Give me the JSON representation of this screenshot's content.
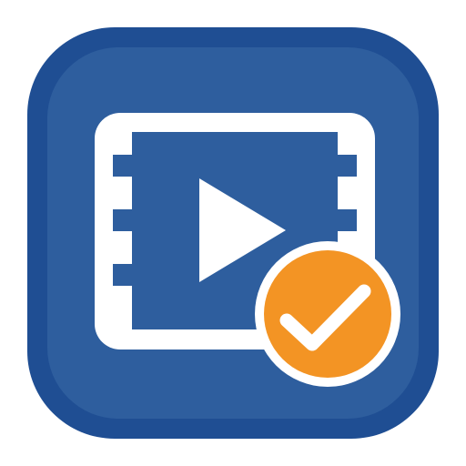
{
  "app_icon": {
    "name": "video-verified-app-icon",
    "icon_names": [
      "film-strip-icon",
      "play-icon",
      "checkmark-badge-icon"
    ],
    "colors": {
      "tile_outer": "#1f4e93",
      "tile_inner": "#2e5e9e",
      "film_frame": "#ffffff",
      "film_screen": "#2e5e9e",
      "play_triangle": "#ffffff",
      "badge_fill": "#f39424",
      "badge_ring": "#ffffff",
      "checkmark": "#ffffff"
    }
  }
}
